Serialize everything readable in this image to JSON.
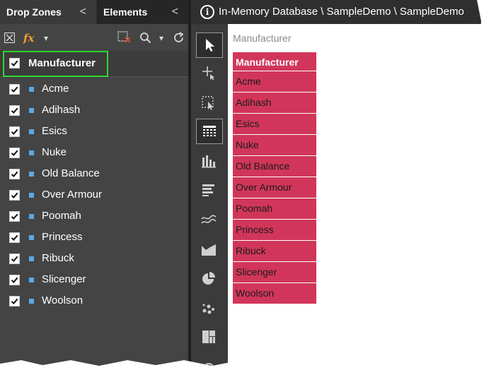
{
  "tabs": {
    "drop_zones": "Drop Zones",
    "elements": "Elements",
    "chevron": "<"
  },
  "toolbar": {
    "fx": "fx",
    "dropdown_arrow": "▾"
  },
  "header": {
    "label": "Manufacturer",
    "checked": true
  },
  "items": [
    {
      "label": "Acme",
      "checked": true
    },
    {
      "label": "Adihash",
      "checked": true
    },
    {
      "label": "Esics",
      "checked": true
    },
    {
      "label": "Nuke",
      "checked": true
    },
    {
      "label": "Old Balance",
      "checked": true
    },
    {
      "label": "Over Armour",
      "checked": true
    },
    {
      "label": "Poomah",
      "checked": true
    },
    {
      "label": "Princess",
      "checked": true
    },
    {
      "label": "Ribuck",
      "checked": true
    },
    {
      "label": "Slicenger",
      "checked": true
    },
    {
      "label": "Woolson",
      "checked": true
    }
  ],
  "top_bar": {
    "path": "In-Memory Database \\ SampleDemo \\ SampleDemo",
    "info_glyph": "i"
  },
  "canvas": {
    "title": "Manufacturer",
    "table_header": "Manufacturer",
    "rows": [
      "Acme",
      "Adihash",
      "Esics",
      "Nuke",
      "Old Balance",
      "Over Armour",
      "Poomah",
      "Princess",
      "Ribuck",
      "Slicenger",
      "Woolson"
    ]
  },
  "strip_icons": [
    "select-pointer-icon",
    "move-cross-icon",
    "area-select-icon",
    "grid-table-icon",
    "column-chart-icon",
    "bar-chart-icon",
    "line-chart-icon",
    "area-chart-icon",
    "pie-chart-icon",
    "scatter-icon",
    "treemap-icon"
  ],
  "colors": {
    "accent_pink": "#d1365a",
    "highlight_green": "#2fd62f",
    "square_blue": "#5aa9e6"
  }
}
